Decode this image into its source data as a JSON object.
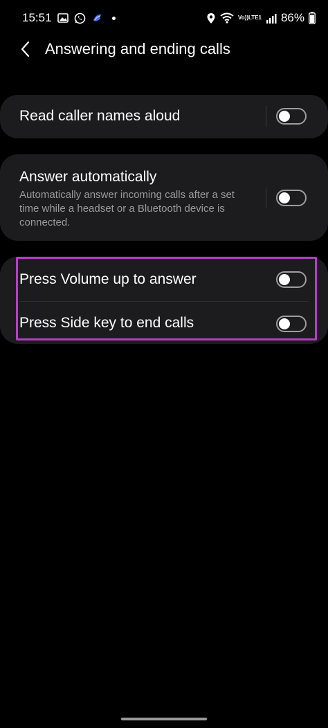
{
  "status_bar": {
    "time": "15:51",
    "battery": "86%",
    "network": "LTE1",
    "volte": "Vo))",
    "icons": [
      "gallery-icon",
      "whatsapp-icon",
      "app-icon",
      "location-icon",
      "wifi-icon",
      "signal-icon",
      "battery-icon"
    ]
  },
  "header": {
    "title": "Answering and ending calls",
    "back_icon": "chevron-left-icon"
  },
  "settings": {
    "read_caller_names": {
      "label": "Read caller names aloud",
      "enabled": false
    },
    "answer_automatically": {
      "label": "Answer automatically",
      "description": "Automatically answer incoming calls after a set time while a headset or a Bluetooth device is connected.",
      "enabled": false
    },
    "press_volume_up": {
      "label": "Press Volume up to answer",
      "enabled": false
    },
    "press_side_key": {
      "label": "Press Side key to end calls",
      "enabled": false
    }
  },
  "colors": {
    "background": "#000000",
    "card": "#1c1c1e",
    "highlight": "#b53ec6",
    "subtext": "#9a9a9a"
  }
}
